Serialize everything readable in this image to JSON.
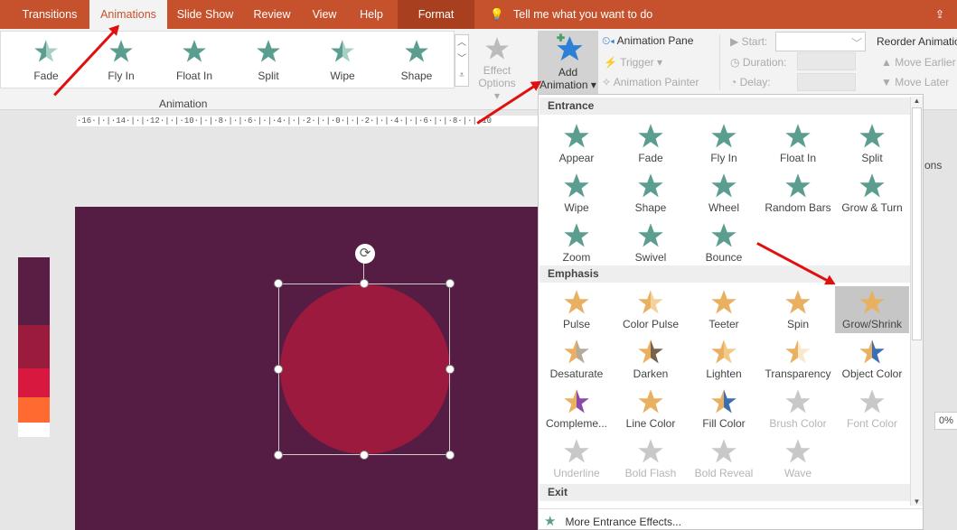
{
  "tabs": [
    "Transitions",
    "Animations",
    "Slide Show",
    "Review",
    "View",
    "Help",
    "Format"
  ],
  "active_tab": "Animations",
  "tell_me": "Tell me what you want to do",
  "gallery": [
    {
      "label": "Fade"
    },
    {
      "label": "Fly In"
    },
    {
      "label": "Float In"
    },
    {
      "label": "Split"
    },
    {
      "label": "Wipe"
    },
    {
      "label": "Shape"
    }
  ],
  "effect_options": {
    "line1": "Effect",
    "line2": "Options ▾"
  },
  "add_animation": {
    "line1": "Add",
    "line2": "Animation ▾"
  },
  "advanced": {
    "pane": "Animation Pane",
    "trigger": "Trigger ▾",
    "painter": "Animation Painter"
  },
  "timing": {
    "start": "Start:",
    "duration": "Duration:",
    "delay": "Delay:"
  },
  "reorder": {
    "title": "Reorder Animation",
    "earlier": "Move Earlier",
    "later": "Move Later"
  },
  "group_label": "Animation",
  "ruler": "·16·|·|·14·|·|·12·|·|·10·|·|·8·|·|·6·|·|·4·|·|·2·|·|·0·|·|·2·|·|·4·|·|·6·|·|·8·|·|·10",
  "theme_colors": [
    "#5a1e45",
    "#9b1b3c",
    "#d8183f",
    "#ff6a30",
    "#ffffff"
  ],
  "slide": {
    "background": "#561d44",
    "shape_color": "#9c1a3e"
  },
  "dropdown": {
    "entrance_header": "Entrance",
    "entrance": [
      "Appear",
      "Fade",
      "Fly In",
      "Float In",
      "Split",
      "Wipe",
      "Shape",
      "Wheel",
      "Random Bars",
      "Grow & Turn",
      "Zoom",
      "Swivel",
      "Bounce"
    ],
    "emphasis_header": "Emphasis",
    "emphasis": [
      {
        "label": "Pulse",
        "c2": "#e8b060"
      },
      {
        "label": "Color Pulse",
        "c2": "#f3d39a"
      },
      {
        "label": "Teeter",
        "c2": "#e8b060"
      },
      {
        "label": "Spin",
        "c2": "#e8b060"
      },
      {
        "label": "Grow/Shrink",
        "c2": "#e8b060",
        "selected": true
      },
      {
        "label": "Desaturate",
        "c2": "#b5aa9a"
      },
      {
        "label": "Darken",
        "c2": "#7a6248"
      },
      {
        "label": "Lighten",
        "c2": "#f3c987"
      },
      {
        "label": "Transparency",
        "c2": "#fbe8cc"
      },
      {
        "label": "Object Color",
        "c2": "#3b6fb3"
      },
      {
        "label": "Compleme...",
        "c2": "#8a4aa8"
      },
      {
        "label": "Line Color",
        "c2": "#e8b060"
      },
      {
        "label": "Fill Color",
        "c2": "#3b6fb3"
      },
      {
        "label": "Brush Color",
        "disabled": true
      },
      {
        "label": "Font Color",
        "disabled": true
      },
      {
        "label": "Underline",
        "disabled": true
      },
      {
        "label": "Bold Flash",
        "disabled": true
      },
      {
        "label": "Bold Reveal",
        "disabled": true
      },
      {
        "label": "Wave",
        "disabled": true
      }
    ],
    "exit_header": "Exit",
    "more": "More Entrance Effects..."
  },
  "right_panel": {
    "partial_label": "ons",
    "percent": "0%"
  },
  "colors": {
    "accent": "#c5522d",
    "entrance_star": "#5b9e8f",
    "emphasis_star": "#e8b060",
    "disabled_star": "#c8c8c8",
    "add_star": "#2e7fd6"
  }
}
